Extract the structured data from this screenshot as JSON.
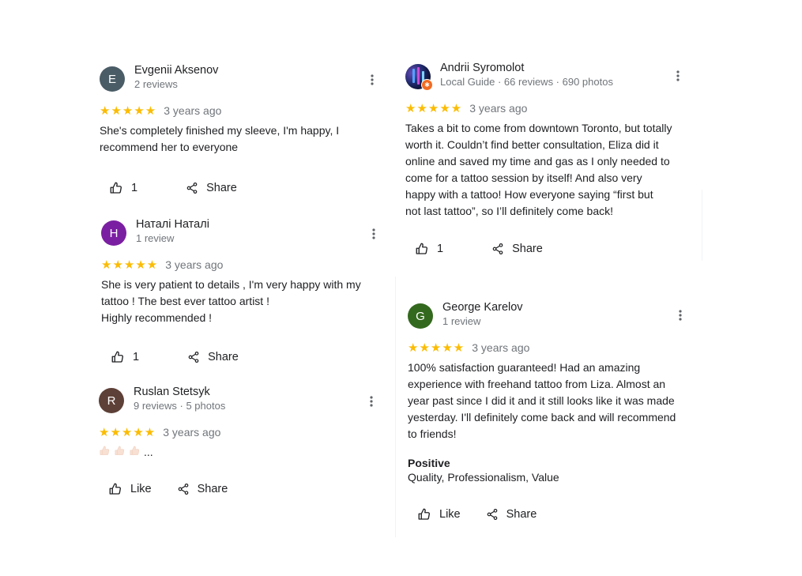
{
  "reviews": [
    {
      "name": "Evgenii Aksenov",
      "meta": "2 reviews",
      "avatar_letter": "E",
      "avatar_color": "#4a5c66",
      "stars": "★★★★★",
      "date": "3 years ago",
      "text": "She's completely finished my sleeve, I'm happy, I\nrecommend her to everyone",
      "like_label": "1",
      "share_label": "Share"
    },
    {
      "name": "Наталі Наталі",
      "meta": "1 review",
      "avatar_letter": "H",
      "avatar_color": "#7b1fa2",
      "stars": "★★★★★",
      "date": "3 years ago",
      "text": "She is very patient to details , I'm very happy with my\ntattoo ! The best ever tattoo artist !\nHighly recommended !",
      "like_label": "1",
      "share_label": "Share"
    },
    {
      "name": "Ruslan Stetsyk",
      "meta": "9 reviews · 5 photos",
      "avatar_letter": "R",
      "avatar_color": "#5d4037",
      "stars": "★★★★★",
      "date": "3 years ago",
      "text_suffix": "...",
      "like_label": "Like",
      "share_label": "Share"
    },
    {
      "name": "Andrii Syromolot",
      "meta": "Local Guide · 66 reviews · 690 photos",
      "avatar_icon": "profile-photo",
      "badge_icon": "local-guide-star-icon",
      "stars": "★★★★★",
      "date": "3 years ago",
      "text": "Takes a bit to come from downtown Toronto, but totally\nworth it. Couldn’t find better consultation, Eliza did it\nonline and saved my time and gas as I only needed to\ncome for a tattoo session by itself! And also very\nhappy with a tattoo! How everyone saying “first but\nnot last tattoo”, so I’ll definitely come back!",
      "like_label": "1",
      "share_label": "Share"
    },
    {
      "name": "George Karelov",
      "meta": "1 review",
      "avatar_letter": "G",
      "avatar_color": "#33691e",
      "stars": "★★★★★",
      "date": "3 years ago",
      "text": "100% satisfaction guaranteed! Had an amazing\nexperience with freehand tattoo from Liza. Almost an\nyear past since I did it and it still looks like it was made\nyesterday. I'll definitely come back and will recommend\nto friends!",
      "positive_label": "Positive",
      "positive_values": "Quality, Professionalism, Value",
      "like_label": "Like",
      "share_label": "Share"
    }
  ],
  "colors": {
    "star": "#fbbc04",
    "meta_text": "#70757a",
    "body_text": "#202124"
  }
}
